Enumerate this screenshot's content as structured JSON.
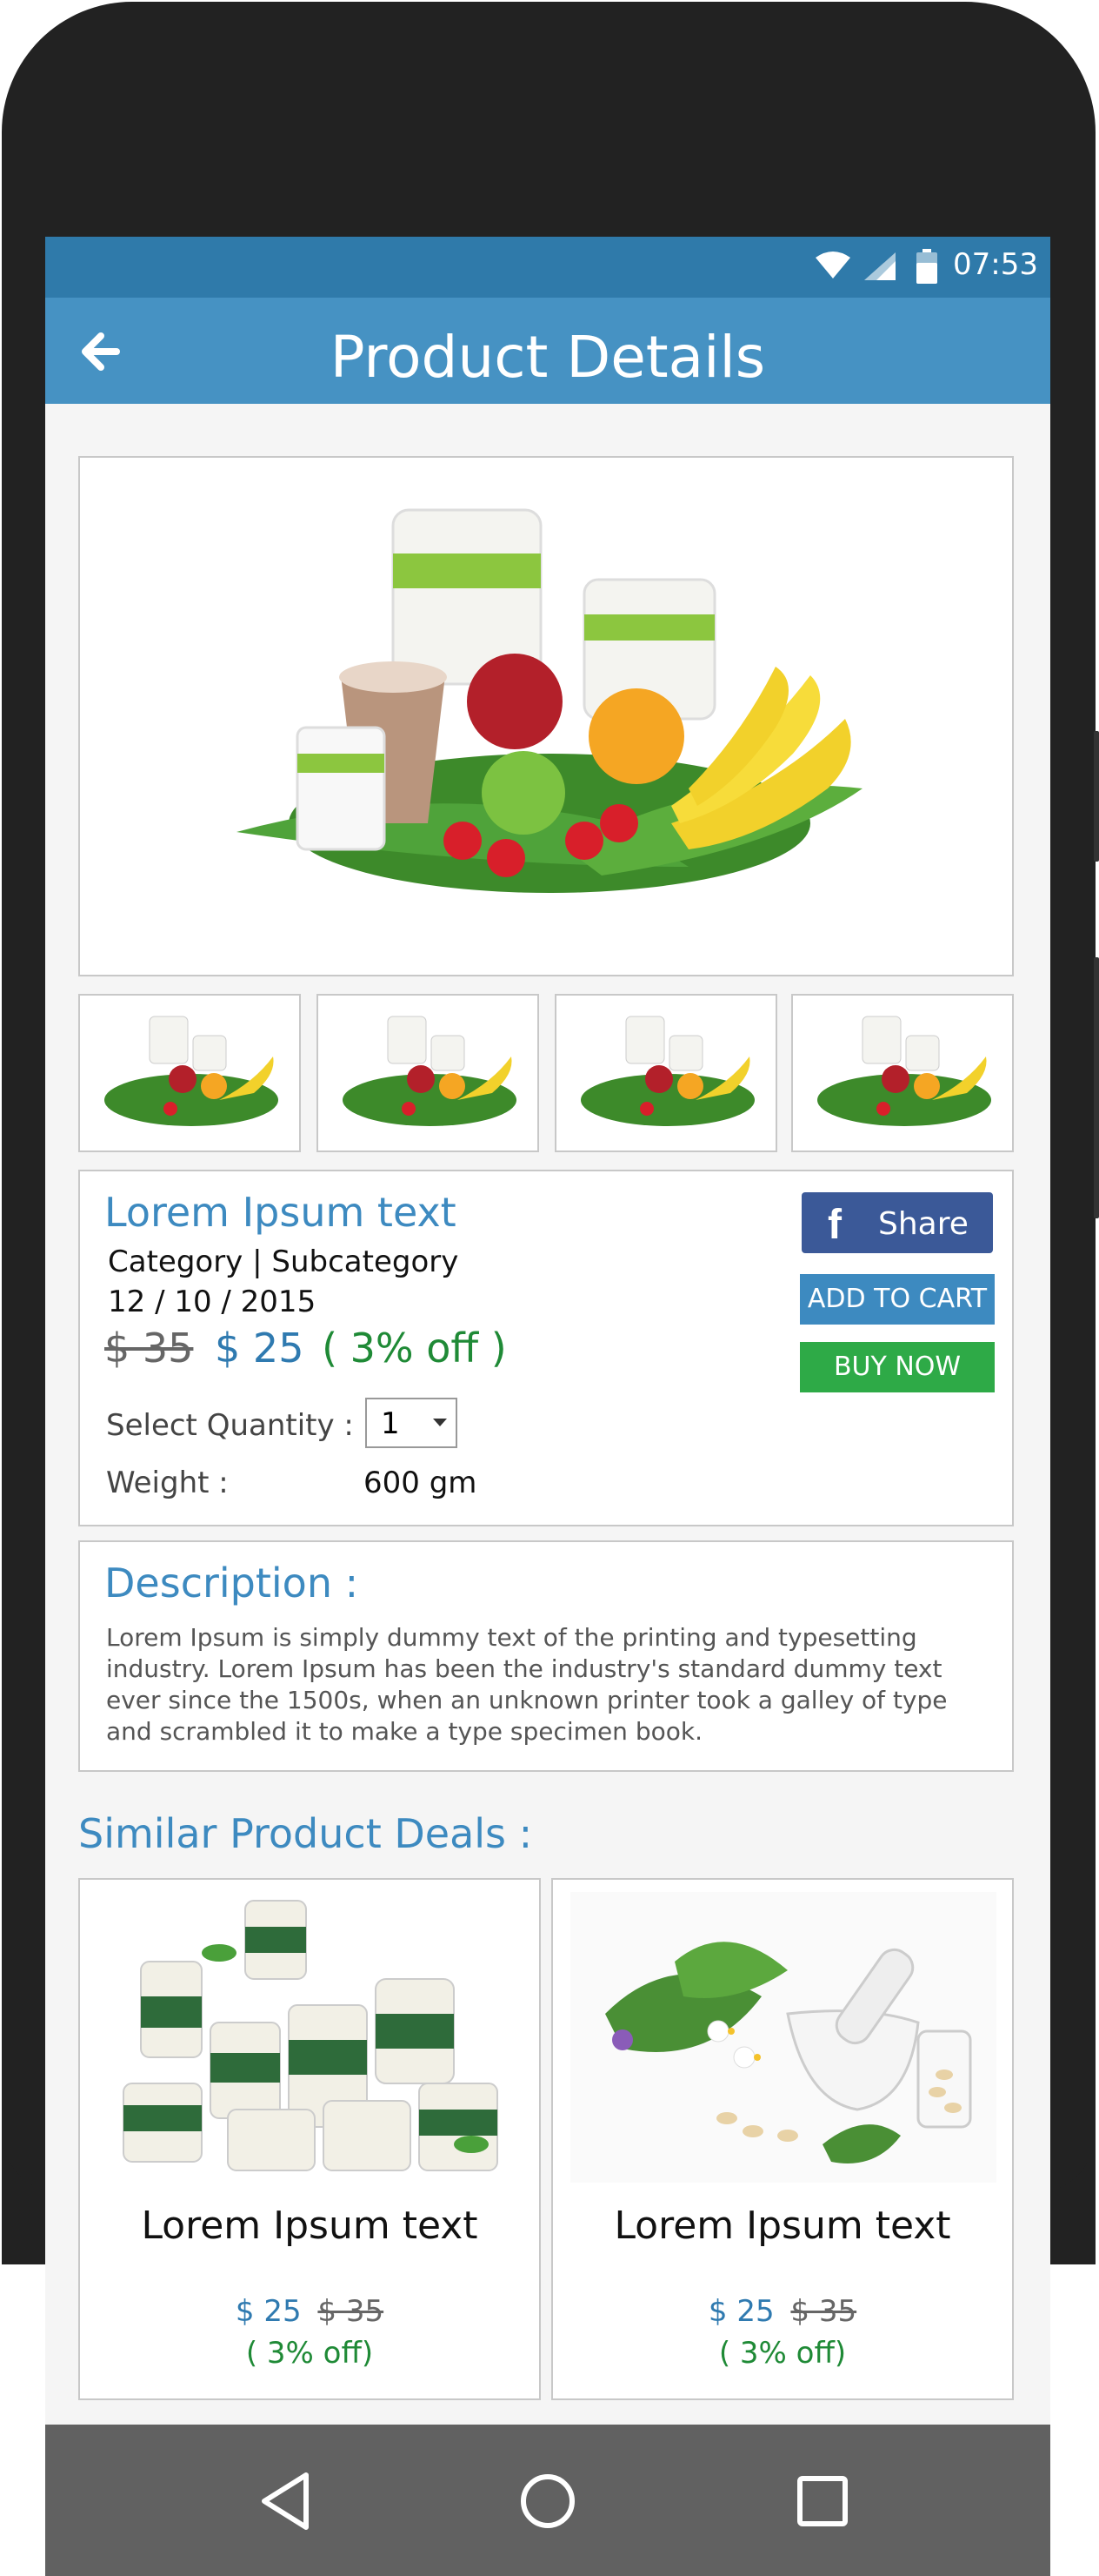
{
  "status_bar": {
    "time": "07:53",
    "icons": [
      "wifi-icon",
      "signal-icon",
      "battery-icon"
    ]
  },
  "app_bar": {
    "title": "Product Details",
    "back_icon": "arrow-left-icon"
  },
  "product": {
    "name": "Lorem Ipsum text",
    "category": "Category | Subcategory",
    "date": "12 / 10 / 2015",
    "old_price": "$ 35",
    "new_price": "$ 25",
    "discount": "( 3% off )",
    "quantity_label": "Select Quantity :",
    "quantity_value": "1",
    "weight_label": "Weight :",
    "weight_value": "600 gm"
  },
  "actions": {
    "share_label": "Share",
    "add_to_cart": "ADD TO CART",
    "buy_now": "BUY NOW"
  },
  "description": {
    "title": "Description :",
    "text": "Lorem Ipsum is simply dummy text of the printing and typesetting industry. Lorem Ipsum has been the industry's standard dummy text ever since the 1500s, when an unknown printer took a galley of type and scrambled it to make a type specimen book."
  },
  "similar": {
    "title": "Similar Product Deals :",
    "items": [
      {
        "name": "Lorem Ipsum text",
        "new_price": "$ 25",
        "old_price": "$ 35",
        "discount": "( 3% off)"
      },
      {
        "name": "Lorem Ipsum text",
        "new_price": "$ 25",
        "old_price": "$ 35",
        "discount": "( 3% off)"
      }
    ]
  },
  "nav_bar": {
    "icons": [
      "back-triangle-icon",
      "home-circle-icon",
      "recents-square-icon"
    ]
  },
  "colors": {
    "status_bar": "#2f7aaa",
    "app_bar": "#4692c3",
    "accent_blue": "#3d8ac0",
    "green": "#2eaa47",
    "facebook": "#3b5998"
  }
}
